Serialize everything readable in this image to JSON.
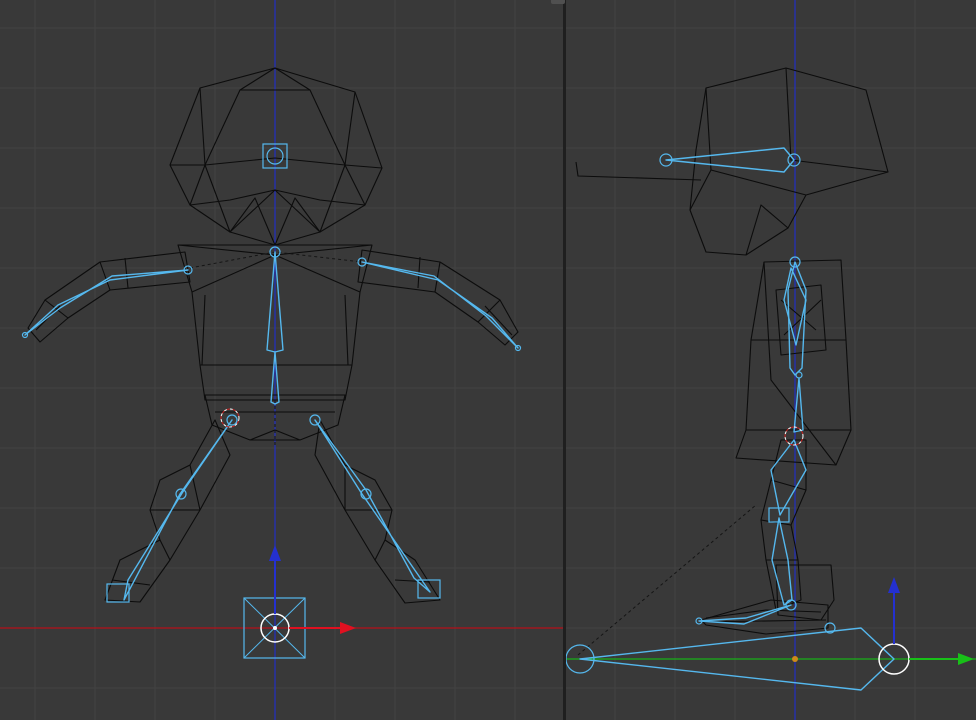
{
  "editor": {
    "type": "3D Viewport",
    "layout": "split-vertical",
    "mode": "wireframe"
  },
  "viewports": [
    {
      "id": "front",
      "view": "front-orthographic",
      "objects": [
        "character-mesh",
        "armature"
      ]
    },
    {
      "id": "side",
      "view": "side-orthographic",
      "objects": [
        "character-mesh",
        "armature"
      ]
    }
  ],
  "colors": {
    "background": "#393939",
    "grid": "#434343",
    "mesh_wire": "#0c0c0c",
    "bone": "#55b8ee",
    "x_axis": "#b4101a",
    "y_axis": "#18b018",
    "z_axis": "#2430b8",
    "cursor_ring": "#d02020",
    "origin_dot": "#d08a1a"
  },
  "icons": [
    "3d-cursor-icon",
    "manipulator-arrow-icon",
    "bone-head-icon"
  ]
}
